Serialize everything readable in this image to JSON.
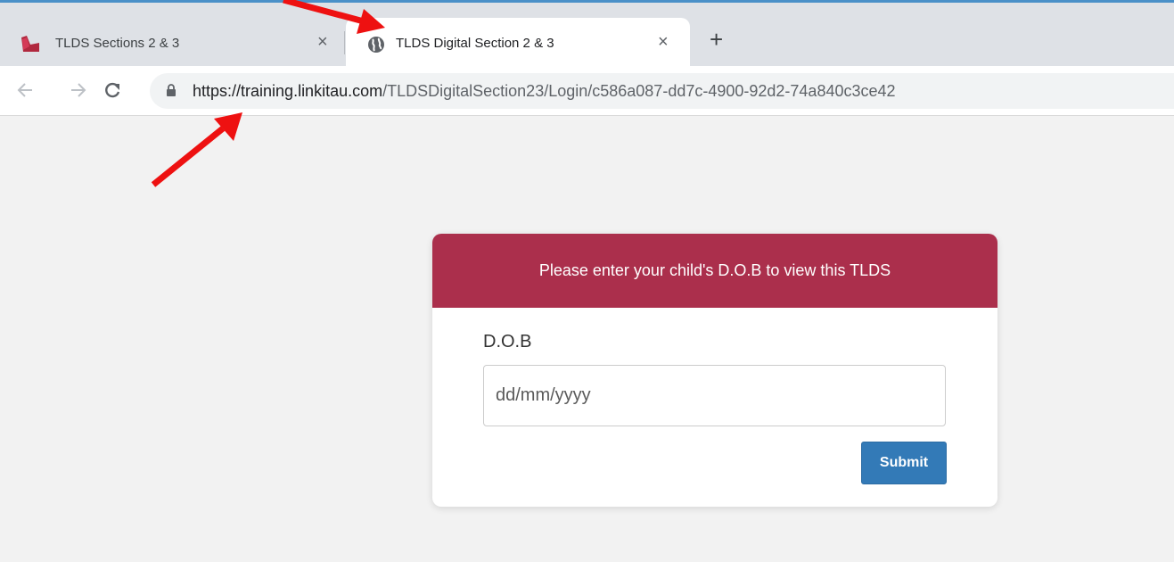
{
  "browser": {
    "tabs": [
      {
        "title": "TLDS Sections 2 & 3",
        "icon": "app-logo-icon",
        "active": false,
        "close": "×"
      },
      {
        "title": "TLDS Digital Section 2 & 3",
        "icon": "globe-icon",
        "active": true,
        "close": "×"
      }
    ],
    "new_tab": "+",
    "address": {
      "url_host": "https://training.linkitau.com",
      "url_path": "/TLDSDigitalSection23/Login/c586a087-dd7c-4900-92d2-74a840c3ce42"
    },
    "accent": "#4a90c8"
  },
  "login_card": {
    "header": "Please enter your child's D.O.B to view this TLDS",
    "header_color": "#ab2f4c",
    "field_label": "D.O.B",
    "input_placeholder": "dd/mm/yyyy",
    "input_value": "",
    "submit_label": "Submit",
    "submit_color": "#337ab7"
  },
  "annotations": {
    "arrow_color": "#ee1111"
  }
}
